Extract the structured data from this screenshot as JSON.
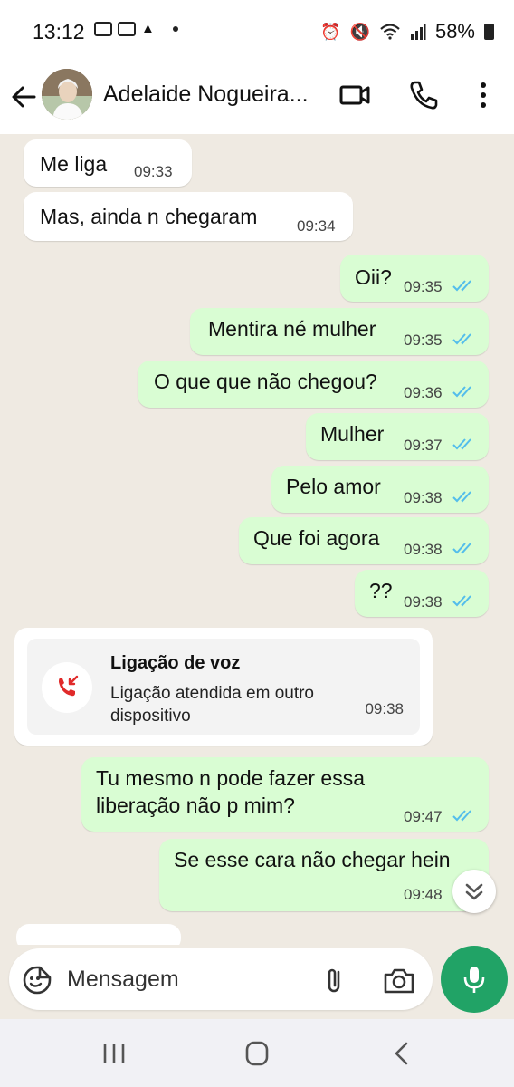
{
  "status_bar": {
    "time": "13:12",
    "battery": "58%"
  },
  "header": {
    "contact_name": "Adelaide Nogueira..."
  },
  "incoming_messages": [
    {
      "text": "Me liga",
      "time": "09:33"
    },
    {
      "text": "Mas, ainda n chegaram",
      "time": "09:34"
    }
  ],
  "outgoing_messages": [
    {
      "text": "Oii?",
      "time": "09:35"
    },
    {
      "text": "Mentira né mulher",
      "time": "09:35"
    },
    {
      "text": "O que que não chegou?",
      "time": "09:36"
    },
    {
      "text": "Mulher",
      "time": "09:37"
    },
    {
      "text": "Pelo amor",
      "time": "09:38"
    },
    {
      "text": "Que foi agora",
      "time": "09:38"
    },
    {
      "text": "??",
      "time": "09:38"
    }
  ],
  "call": {
    "title": "Ligação de voz",
    "subtitle": "Ligação atendida em outro dispositivo",
    "time": "09:38"
  },
  "later_messages": [
    {
      "text": "Tu mesmo n pode fazer essa liberação não p mim?",
      "line1": "Tu mesmo n pode fazer essa",
      "line2": "liberação não p mim?",
      "time": "09:47"
    },
    {
      "text": "Se esse cara não chegar hein",
      "time": "09:48"
    }
  ],
  "composer": {
    "placeholder": "Mensagem"
  },
  "colors": {
    "chat_background": "#efeae2",
    "outgoing_bubble": "#d9fdd3",
    "incoming_bubble": "#ffffff",
    "read_ticks": "#53bdeb",
    "mic_button": "#21a366",
    "missed_call_icon": "#e02a2a"
  },
  "icons": [
    "back-arrow-icon",
    "video-call-icon",
    "phone-icon",
    "more-vert-icon",
    "double-check-icon",
    "missed-call-icon",
    "chevron-double-down-icon",
    "sticker-icon",
    "attach-icon",
    "camera-icon",
    "mic-icon",
    "recent-apps-icon",
    "home-icon",
    "nav-back-icon"
  ]
}
